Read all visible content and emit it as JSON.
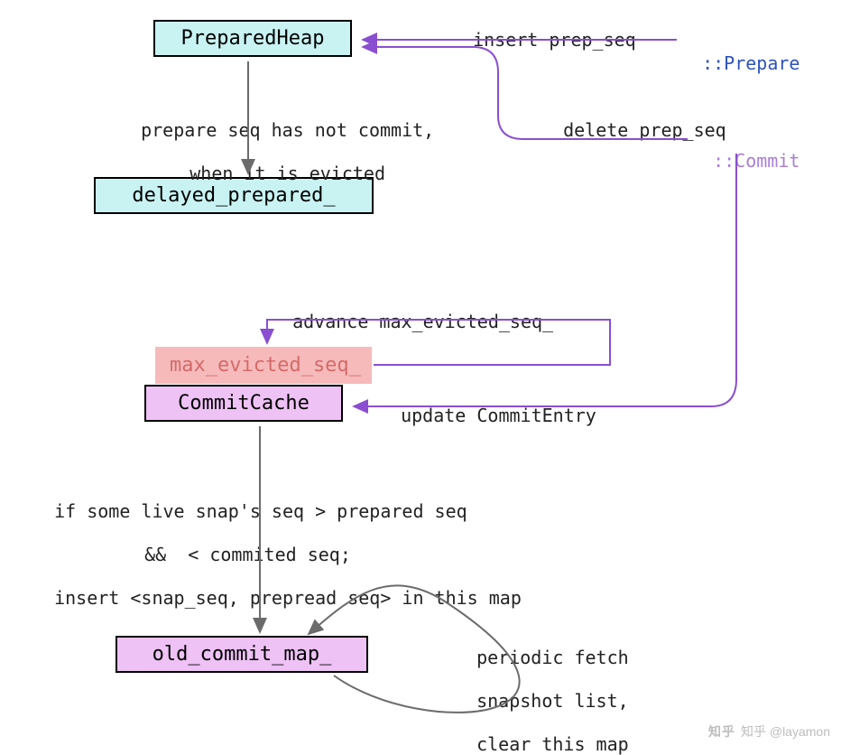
{
  "boxes": {
    "prepared_heap": "PreparedHeap",
    "delayed_prepared": "delayed_prepared_",
    "max_evicted_seq": "max_evicted_seq_",
    "commit_cache": "CommitCache",
    "old_commit_map": "old_commit_map_"
  },
  "labels": {
    "insert_prep_seq": "insert prep_seq",
    "prepare": "::Prepare",
    "delete_prep_seq": "delete prep_seq",
    "commit": "::Commit",
    "prepare_seq_note_l1": "prepare seq has not commit,",
    "prepare_seq_note_l2": "when it is evicted",
    "advance": "advance max_evicted_seq_",
    "update_entry": "update CommitEntry",
    "snap_note_l1": "if some live snap's seq > prepared seq",
    "snap_note_l2": "&&  < commited seq;",
    "snap_note_l3": "insert <snap_seq, prepread seq> in this map",
    "periodic_l1": "periodic fetch",
    "periodic_l2": "snapshot list,",
    "periodic_l3": "clear this map"
  },
  "colors": {
    "cyan_box": "#c9f3f3",
    "pink_box": "#f6baba",
    "violet_box": "#eec2f5",
    "prepare_text": "#2d52c2",
    "commit_text": "#a87ed8",
    "pink_text": "#d46a6a",
    "arrow_gray": "#6b6b6b",
    "arrow_purple": "#8a4fd0"
  },
  "watermark": "知乎 @layamon"
}
